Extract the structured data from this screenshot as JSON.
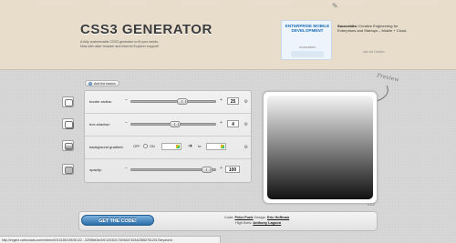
{
  "header": {
    "title": "CSS3 GENERATOR",
    "subtitle_line1": "A fully customizable CSS3 generator to fit your needs.",
    "subtitle_line2": "Now with older browser and Internet Explorer support!"
  },
  "ad": {
    "image_title": "ENTERPRISE MOBILE DEVELOPMENT",
    "image_sub": "SOURCEBITS",
    "brand": "Sourcebits:",
    "text": "Creative Engineering for Enterprises and Startups – Mobile + Cloud.",
    "via": "ads via Carbon"
  },
  "controls": {
    "add_basics_label": "Add the basics",
    "rows": [
      {
        "label": "border-radius:",
        "value": "25",
        "slider_fraction": 0.62
      },
      {
        "label": "box-shadow:",
        "value": "4",
        "slider_fraction": 0.52
      },
      {
        "label": "background gradient:",
        "off_label": "OFF",
        "on_label": "ON",
        "to_label": "to:"
      },
      {
        "label": "opacity:",
        "value": "100",
        "slider_fraction": 0.96
      }
    ],
    "minus": "–",
    "plus": "+"
  },
  "preview": {
    "label": "Preview",
    "version": "v 2.2",
    "gradient_top": "#f4f4f4",
    "gradient_bottom": "#111111"
  },
  "footer": {
    "get_code_label": "GET THE CODE!",
    "code_label": "Code:",
    "code_author": "Peter Funk",
    "design_label": "Design:",
    "design_author": "Eric Hoffman",
    "highfives_label": "High fives:",
    "highfives_author": "Anthony Lagoon"
  },
  "status_bar": {
    "url": "http://engine.carbonads.com/redirect/0/13135/13926/122...32905b04e3/0/1203/21700/63471634235827612017keyword="
  },
  "colors": {
    "header_bg": "#e8dccb",
    "button_blue": "#2b6ea8",
    "title": "#3b3b3b"
  }
}
